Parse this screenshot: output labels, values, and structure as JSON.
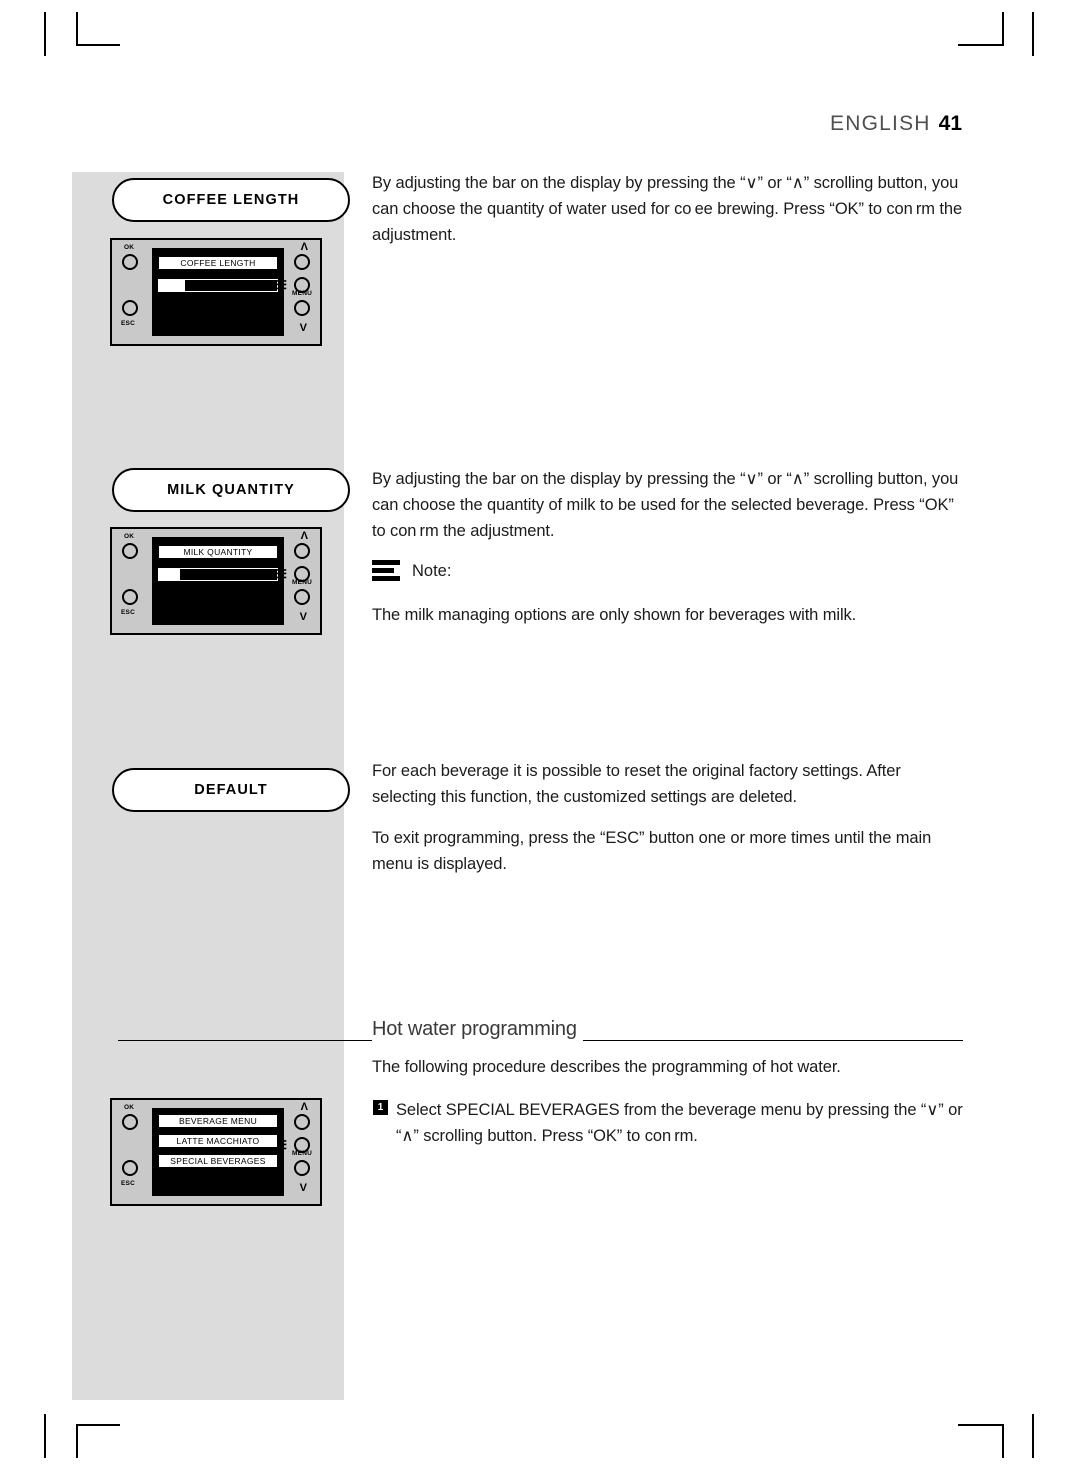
{
  "header": {
    "language": "ENGLISH",
    "page_number": "41"
  },
  "sections": [
    {
      "pill_label": "COFFEE LENGTH",
      "panel": {
        "lcd_lines": [
          "COFFEE LENGTH"
        ],
        "bar_fill_percent": 22,
        "left_labels": [
          "OK",
          "ESC"
        ],
        "right_labels": [
          "MENU"
        ],
        "up_glyph": "Λ",
        "down_glyph": "V"
      },
      "paragraphs": [
        "By adjusting the bar on the display  by pressing the “∨” or “∧” scrolling button, you can choose the quantity of water used for co ee brewing. Press “OK” to con rm the adjustment."
      ]
    },
    {
      "pill_label": "MILK QUANTITY",
      "panel": {
        "lcd_lines": [
          "MILK QUANTITY"
        ],
        "bar_fill_percent": 18,
        "left_labels": [
          "OK",
          "ESC"
        ],
        "right_labels": [
          "MENU"
        ],
        "up_glyph": "Λ",
        "down_glyph": "V"
      },
      "paragraphs": [
        "By adjusting the bar on the display by pressing the “∨” or “∧” scrolling button, you can choose the quantity of milk to be used for the selected beverage. Press “OK” to con rm the adjustment."
      ]
    },
    {
      "pill_label": "DEFAULT",
      "paragraphs": [
        "For each beverage it is possible to reset the original factory settings. After selecting this function, the customized settings are deleted.",
        "To exit programming, press the “ESC” button one or more times until the main menu is displayed."
      ]
    }
  ],
  "note": {
    "label": "Note:",
    "text": "The milk managing options are only shown for beverages with milk."
  },
  "hot_water": {
    "title": "Hot water programming",
    "intro": "The following procedure describes the programming of hot water.",
    "step_number": "1",
    "step_text": "Select SPECIAL BEVERAGES from the beverage menu by pressing the “∨” or “∧” scrolling button. Press “OK” to con rm.",
    "panel": {
      "lcd_lines": [
        "BEVERAGE MENU",
        "LATTE MACCHIATO",
        "SPECIAL BEVERAGES"
      ],
      "left_labels": [
        "OK",
        "ESC"
      ],
      "right_labels": [
        "MENU"
      ],
      "up_glyph": "Λ",
      "down_glyph": "V"
    }
  }
}
